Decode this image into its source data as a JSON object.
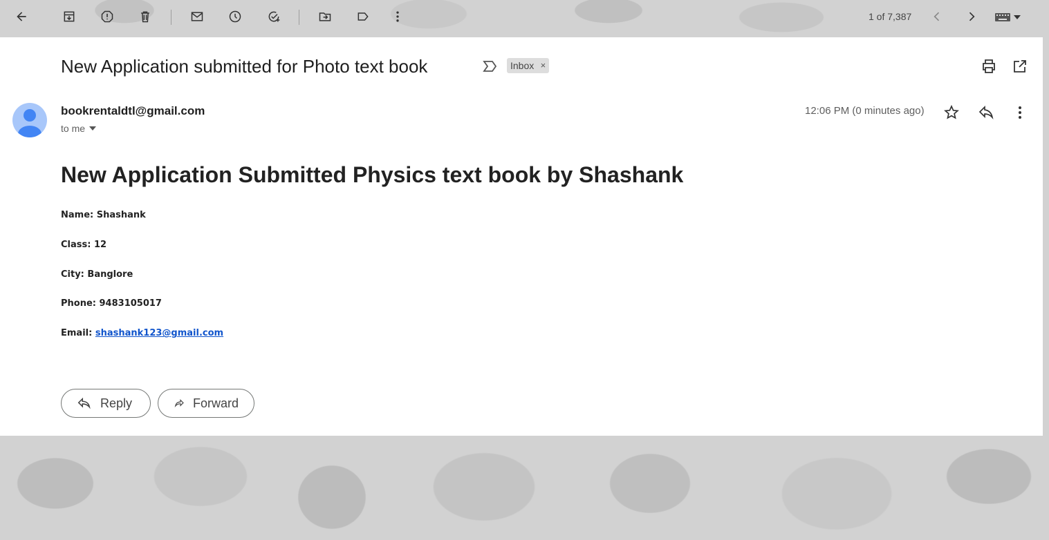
{
  "toolbar": {
    "icons": [
      "back-arrow-icon",
      "archive-icon",
      "report-spam-icon",
      "delete-icon",
      "mark-unread-icon",
      "snooze-icon",
      "add-task-icon",
      "move-to-icon",
      "label-icon",
      "more-vert-icon"
    ],
    "pager_text": "1 of 7,387"
  },
  "email": {
    "subject": "New Application submitted for Photo text book",
    "label": "Inbox",
    "label_remove": "×",
    "sender_email": "bookrentaldtl@gmail.com",
    "to_text": "to me",
    "time": "12:06 PM (0 minutes ago)",
    "body_title": "New Application Submitted Physics text book by Shashank",
    "fields": [
      {
        "label": "Name:",
        "value": "Shashank"
      },
      {
        "label": "Class:",
        "value": "12"
      },
      {
        "label": "City:",
        "value": "Banglore"
      },
      {
        "label": "Phone:",
        "value": "9483105017"
      }
    ],
    "email_label": "Email:",
    "email_value": "shashank123@gmail.com"
  },
  "actions": {
    "reply_label": "Reply",
    "forward_label": "Forward"
  },
  "colors": {
    "link": "#1155cc",
    "avatar_bg": "#a8c7fa",
    "avatar_fg": "#4285f4"
  }
}
